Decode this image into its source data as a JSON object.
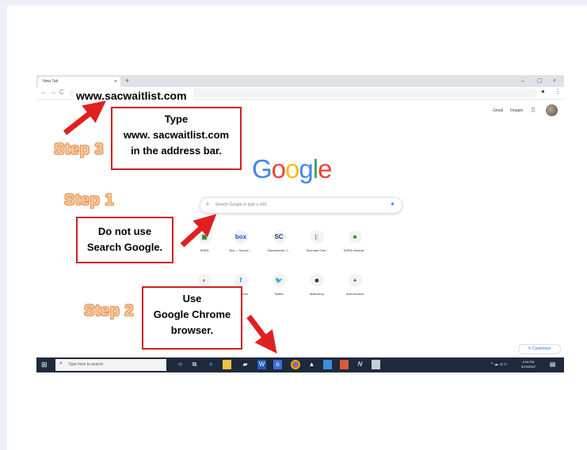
{
  "browser": {
    "tab_title": "New Tab",
    "tab_close": "×",
    "new_tab": "+",
    "win_min": "–",
    "win_max": "▢",
    "win_close": "×"
  },
  "toolbar": {
    "back": "←",
    "forward": "→",
    "reload": "C"
  },
  "header": {
    "gmail": "Gmail",
    "images": "Images",
    "apps": "⋮⋮⋮"
  },
  "logo": {
    "letters": [
      "G",
      "o",
      "o",
      "g",
      "l",
      "e"
    ],
    "colors": [
      "#4285f4",
      "#ea4335",
      "#fbbc05",
      "#4285f4",
      "#34a853",
      "#ea4335"
    ]
  },
  "search": {
    "placeholder": "Search Google or type a URL",
    "icon": "🔍",
    "mic": "🎤"
  },
  "shortcuts": [
    {
      "label": "SHRA",
      "glyph": "▣",
      "color": "#2e7d32"
    },
    {
      "label": "Box -- Secure ...",
      "glyph": "box",
      "color": "#0061d5"
    },
    {
      "label": "Sacramento C...",
      "glyph": "SC",
      "color": "#1a3c6e"
    },
    {
      "label": "Timecard Onli...",
      "glyph": "|:",
      "color": "#888888"
    },
    {
      "label": "SHRA Intranet...",
      "glyph": "♣",
      "color": "#3b7d23"
    },
    {
      "label": "",
      "glyph": "◐",
      "color": "#c0392b"
    },
    {
      "label": "Facebook",
      "glyph": "f",
      "color": "#1877f2"
    },
    {
      "label": "Twitter",
      "glyph": "🐦",
      "color": "#1da1f2"
    },
    {
      "label": "Mailchimp",
      "glyph": "☻",
      "color": "#222222"
    },
    {
      "label": "Add shortcut",
      "glyph": "+",
      "color": "#444444"
    }
  ],
  "customize": {
    "label": "✎ Customize"
  },
  "taskbar": {
    "search_text": "Type here to search",
    "clock_time": "4:34 PM",
    "clock_date": "5/13/2022",
    "tray_icons": "^ ☁ ◁ ▭"
  },
  "annotations": {
    "url": "www.sacwaitlist.com",
    "step3": "Step 3",
    "step3_lines": [
      "Type",
      "www. sacwaitlist.com",
      "in the address bar."
    ],
    "step1": "Step 1",
    "step1_lines": [
      "Do not use",
      "Search Google."
    ],
    "step2": "Step 2",
    "step2_lines": [
      "Use",
      "Google Chrome",
      "browser."
    ]
  },
  "colors": {
    "callout_border": "#d42020",
    "arrow": "#e02020",
    "step_text": "#f8c89c",
    "taskbar": "#1e2a3c"
  }
}
